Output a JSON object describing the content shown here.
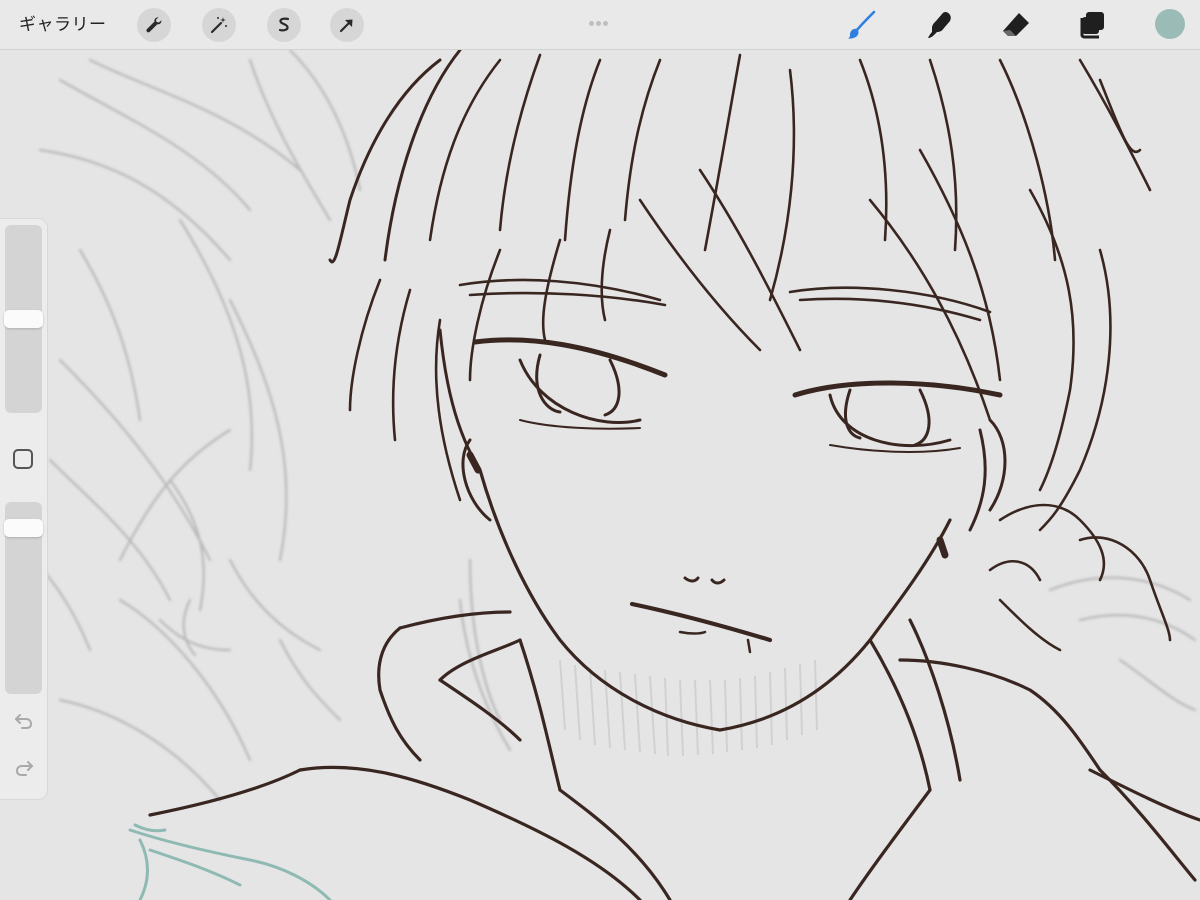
{
  "toolbar": {
    "gallery_label": "ギャラリー",
    "left_tools": [
      {
        "name": "actions",
        "icon": "wrench-icon"
      },
      {
        "name": "adjustments",
        "icon": "magic-wand-icon"
      },
      {
        "name": "selection",
        "icon": "selection-s-icon"
      },
      {
        "name": "transform",
        "icon": "arrow-cursor-icon"
      }
    ],
    "right_tools": [
      {
        "name": "brush",
        "icon": "brush-icon",
        "active": true
      },
      {
        "name": "smudge",
        "icon": "smudge-finger-icon",
        "active": false
      },
      {
        "name": "eraser",
        "icon": "eraser-icon",
        "active": false
      },
      {
        "name": "layers",
        "icon": "layers-icon",
        "active": false
      }
    ],
    "current_color": "#9bbcb6"
  },
  "sidebar": {
    "brush_size_level": 0.5,
    "opacity_level": 0.9,
    "modify_icon": "square-modify-icon",
    "undo_icon": "undo-icon",
    "redo_icon": "redo-icon"
  },
  "colors": {
    "active_tool": "#2f7fe0",
    "inactive_tool": "#1f1f1f",
    "ink": "#3a2620",
    "sketch": "#a8a8a8",
    "teal_stroke": "#8fbab3",
    "paper": "#e6e6e6"
  }
}
